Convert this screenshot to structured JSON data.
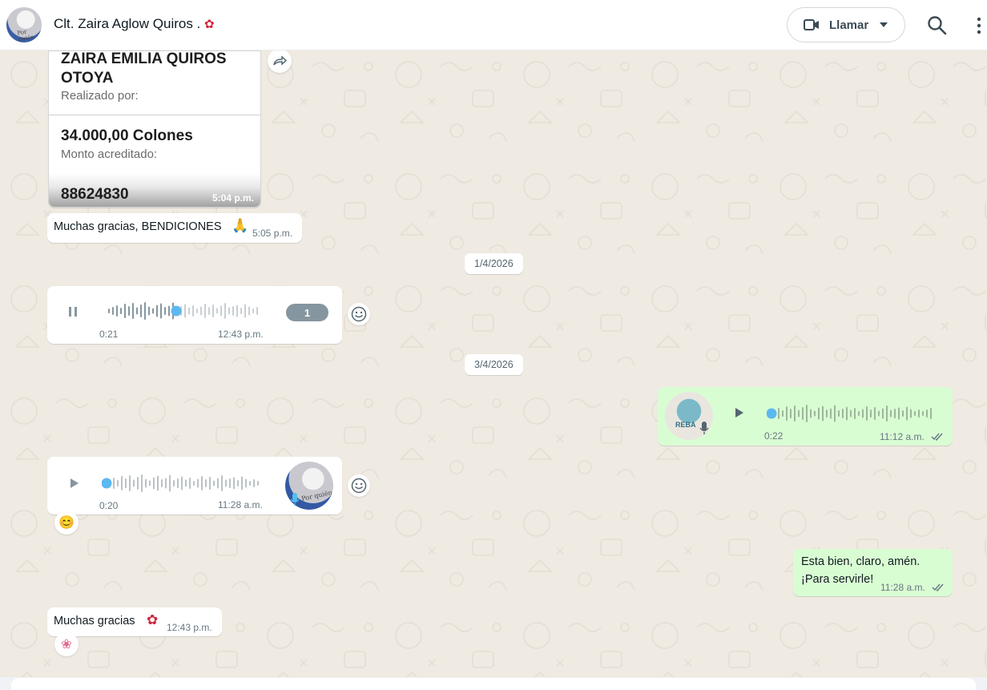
{
  "header": {
    "chat_name": "Clt. Zaira Aglow Quiros .",
    "call_label": "Llamar"
  },
  "receipt": {
    "name": "ZAIRA EMILIA QUIROS OTOYA",
    "name_label": "Realizado por:",
    "amount": "34.000,00 Colones",
    "amount_label": "Monto acreditado:",
    "number": "88624830",
    "time": "5:04 p.m."
  },
  "messages": {
    "thanks_blessings": {
      "text": "Muchas gracias, BENDICIONES",
      "time": "5:05 p.m."
    },
    "date_1": "1/4/2026",
    "voice_in_1": {
      "duration": "0:21",
      "time": "12:43 p.m.",
      "speed": "1"
    },
    "date_2": "3/4/2026",
    "voice_out_1": {
      "duration": "0:22",
      "time": "11:12 a.m."
    },
    "voice_in_2": {
      "duration": "0:20",
      "time": "11:28 a.m."
    },
    "reply_out": {
      "line1": "Esta bien, claro, amén.",
      "line2": "¡Para servirle!",
      "time": "11:28 a.m."
    },
    "thanks": {
      "text": "Muchas gracias",
      "time": "12:43 p.m."
    }
  },
  "colors": {
    "chat_bg": "#efeae2",
    "incoming_bubble": "#ffffff",
    "outgoing_bubble": "#d9fdd3",
    "played_wave": "#5bb8f0"
  },
  "icons": [
    "video-camera-icon",
    "chevron-down-icon",
    "search-icon",
    "more-vert-icon",
    "forward-icon",
    "pause-icon",
    "play-icon",
    "emoji-icon",
    "microphone-icon",
    "double-check-icon"
  ]
}
